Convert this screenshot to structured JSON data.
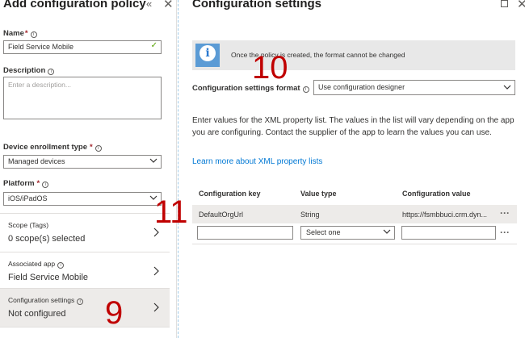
{
  "left_blade": {
    "title": "Add configuration policy",
    "collapse_icon": "«",
    "close_icon": "✕",
    "name_label": "Name",
    "name_value": "Field Service Mobile",
    "description_label": "Description",
    "description_placeholder": "Enter a description...",
    "device_enrollment_label": "Device enrollment type",
    "device_enrollment_value": "Managed devices",
    "platform_label": "Platform",
    "platform_value": "iOS/iPadOS",
    "required_mark": "*",
    "info_glyph": "i",
    "nav": [
      {
        "title": "Scope (Tags)",
        "value": "0 scope(s) selected"
      },
      {
        "title": "Associated app",
        "value": "Field Service Mobile"
      },
      {
        "title": "Configuration settings",
        "value": "Not configured"
      }
    ]
  },
  "right_blade": {
    "title": "Configuration settings",
    "close_icon": "✕",
    "info_icon_glyph": "i",
    "info_text": "Once the policy is created, the format cannot be changed",
    "format_label": "Configuration settings format",
    "format_value": "Use configuration designer",
    "description": "Enter values for the XML property list. The values in the list will vary depending on the app you are configuring. Contact the supplier of the app to learn the values you can use.",
    "learn_more": "Learn more about XML property lists",
    "table": {
      "headers": [
        "Configuration key",
        "Value type",
        "Configuration value"
      ],
      "rows": [
        {
          "key": "DefaultOrgUrl",
          "type": "String",
          "value": "https://fsmbbuci.crm.dyn..."
        }
      ],
      "new_row_type_placeholder": "Select one",
      "more_icon": "···"
    }
  },
  "callouts": [
    "10",
    "11",
    "9"
  ],
  "colors": {
    "accent": "#0078d4",
    "required": "#a4262c",
    "callout": "#c00000",
    "info_banner_bg": "#e8e8e8",
    "info_icon_bg": "#5b9bd5",
    "selected_row_bg": "#edebe9",
    "valid_check": "#57a300"
  },
  "icons": [
    "collapse-icon",
    "close-icon",
    "info-icon",
    "checkmark-icon",
    "chevron-down-icon",
    "chevron-right-icon",
    "maximize-icon",
    "more-icon"
  ]
}
